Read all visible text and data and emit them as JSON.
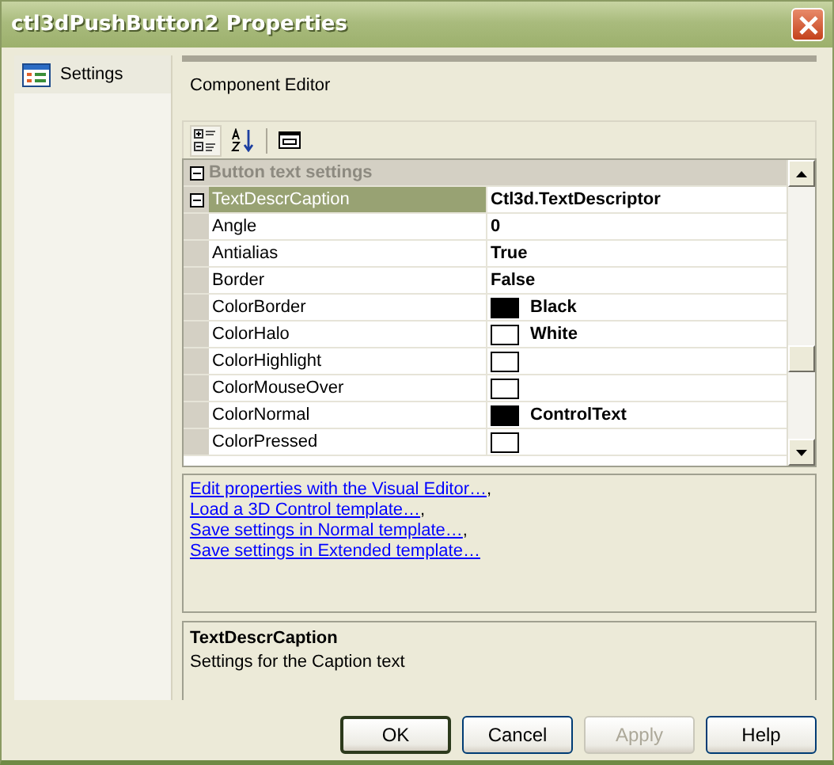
{
  "window": {
    "title": "ctl3dPushButton2 Properties"
  },
  "sidebar": {
    "items": [
      {
        "label": "Settings",
        "selected": true
      }
    ]
  },
  "page": {
    "title": "Component Editor"
  },
  "toolbar": [
    {
      "kind": "categorized",
      "selected": true
    },
    {
      "kind": "alphabetical",
      "selected": false
    },
    {
      "kind": "pages",
      "selected": false
    }
  ],
  "property_grid": {
    "category": {
      "label": "Button text settings",
      "expanded": true
    },
    "rows": [
      {
        "kind": "group",
        "name": "TextDescrCaption",
        "value": "Ctl3d.TextDescriptor",
        "expanded": true,
        "selected": true
      },
      {
        "kind": "text",
        "name": "Angle",
        "value": "0",
        "selected": false
      },
      {
        "kind": "text",
        "name": "Antialias",
        "value": "True",
        "selected": false
      },
      {
        "kind": "text",
        "name": "Border",
        "value": "False",
        "selected": false
      },
      {
        "kind": "color",
        "name": "ColorBorder",
        "value": "Black",
        "color": "#000000",
        "selected": false
      },
      {
        "kind": "color",
        "name": "ColorHalo",
        "value": "White",
        "color": "#ffffff",
        "selected": false
      },
      {
        "kind": "color",
        "name": "ColorHighlight",
        "color": "#ffffff",
        "selected": false
      },
      {
        "kind": "color",
        "name": "ColorMouseOver",
        "color": "#ffffff",
        "selected": false
      },
      {
        "kind": "color",
        "name": "ColorNormal",
        "value": "ControlText",
        "color": "#000000",
        "selected": false
      },
      {
        "kind": "color",
        "name": "ColorPressed",
        "color": "#ffffff",
        "selected": false
      }
    ]
  },
  "links": [
    {
      "text": "Edit properties with the Visual Editor…",
      "after": ","
    },
    {
      "text": "Load a 3D Control template…",
      "after": ","
    },
    {
      "text": "Save settings in Normal template…",
      "after": ","
    },
    {
      "text": "Save settings in Extended template…"
    }
  ],
  "description": {
    "title": "TextDescrCaption",
    "text": "Settings for the Caption text"
  },
  "buttons": [
    {
      "label": "OK",
      "default": true,
      "disabled": false
    },
    {
      "label": "Cancel",
      "default": false,
      "disabled": false
    },
    {
      "label": "Apply",
      "default": false,
      "disabled": true
    },
    {
      "label": "Help",
      "default": false,
      "disabled": false
    }
  ]
}
